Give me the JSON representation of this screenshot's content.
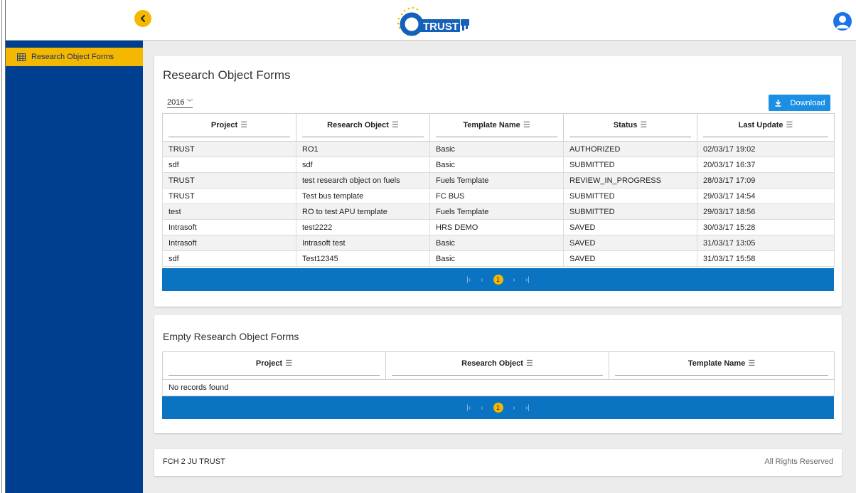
{
  "header": {
    "logo_text": "TRUST",
    "collapse_label": "‹"
  },
  "sidebar": {
    "items": [
      {
        "label": "Research Object Forms",
        "icon": "grid-icon"
      }
    ]
  },
  "forms": {
    "title": "Research Object Forms",
    "year": "2016",
    "download_label": "Download",
    "columns": [
      "Project",
      "Research Object",
      "Template Name",
      "Status",
      "Last Update"
    ],
    "rows": [
      [
        "TRUST",
        "RO1",
        "Basic",
        "AUTHORIZED",
        "02/03/17 19:02"
      ],
      [
        "sdf",
        "sdf",
        "Basic",
        "SUBMITTED",
        "20/03/17 16:37"
      ],
      [
        "TRUST",
        "test research object on fuels",
        "Fuels Template",
        "REVIEW_IN_PROGRESS",
        "28/03/17 17:09"
      ],
      [
        "TRUST",
        "Test bus template",
        "FC BUS",
        "SUBMITTED",
        "29/03/17 14:54"
      ],
      [
        "test",
        "RO to test APU template",
        "Fuels Template",
        "SUBMITTED",
        "29/03/17 18:56"
      ],
      [
        "Intrasoft",
        "test2222",
        "HRS DEMO",
        "SAVED",
        "30/03/17 15:28"
      ],
      [
        "Intrasoft",
        "Intrasoft test",
        "Basic",
        "SAVED",
        "31/03/17 13:05"
      ],
      [
        "sdf",
        "Test12345",
        "Basic",
        "SAVED",
        "31/03/17 15:58"
      ]
    ],
    "pager": {
      "first": "|‹",
      "prev": "‹",
      "page": "1",
      "next": "›",
      "last": "›|"
    }
  },
  "empty_forms": {
    "title": "Empty Research Object Forms",
    "columns": [
      "Project",
      "Research Object",
      "Template Name"
    ],
    "empty_message": "No records found",
    "pager": {
      "first": "|‹",
      "prev": "‹",
      "page": "1",
      "next": "›",
      "last": "›|"
    }
  },
  "footer": {
    "left": "FCH 2 JU TRUST",
    "right": "All Rights Reserved"
  },
  "colors": {
    "accent": "#f5b800",
    "sidebar_bg": "#003f8f",
    "paginator_bg": "#0a73c2",
    "button_bg": "#1a8fe3"
  }
}
